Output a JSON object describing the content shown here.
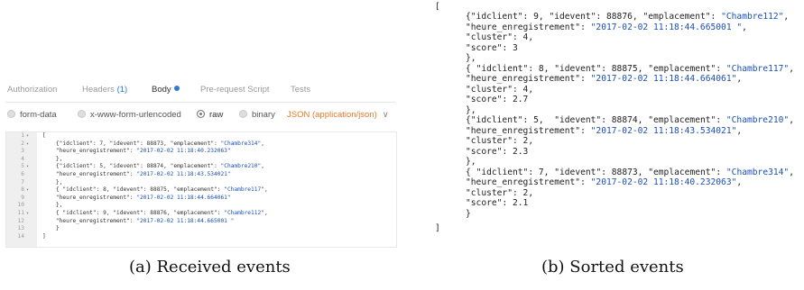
{
  "panel_a": {
    "tabs": [
      {
        "label": "Authorization"
      },
      {
        "label": "Headers",
        "count": "(1)"
      },
      {
        "label": "Body",
        "active": true
      },
      {
        "label": "Pre-request Script"
      },
      {
        "label": "Tests"
      }
    ],
    "body_types": [
      {
        "label": "form-data",
        "selected": false
      },
      {
        "label": "x-www-form-urlencoded",
        "selected": false
      },
      {
        "label": "raw",
        "selected": true
      },
      {
        "label": "binary",
        "selected": false
      }
    ],
    "content_type": "JSON (application/json)",
    "line_numbers": [
      "1",
      "2",
      "3",
      "4",
      "5",
      "6",
      "7",
      "8",
      "9",
      "10",
      "11",
      "12",
      "13",
      "14"
    ],
    "events": [
      {
        "idclient": "7",
        "idevent": "88873",
        "emplacement": "\"Chambre314\"",
        "heure": "\"2017-02-02 11:18:40.232063\""
      },
      {
        "idclient": "5",
        "idevent": "88874",
        "emplacement": "\"Chambre210\"",
        "heure": "\"2017-02-02 11:18:43.534021\""
      },
      {
        "idclient": "8",
        "idevent": "88875",
        "emplacement": "\"Chambre117\"",
        "heure": "\"2017-02-02 11:18:44.664061\""
      },
      {
        "idclient": "9",
        "idevent": "88876",
        "emplacement": "\"Chambre112\"",
        "heure": "\"2017-02-02 11:18:44.665001 \""
      }
    ],
    "caption": "(a) Received events"
  },
  "panel_b": {
    "events": [
      {
        "idclient": "9",
        "idevent": "88876",
        "emplacement": "\"Chambre112\"",
        "heure": "\"2017-02-02 11:18:44.665001 \"",
        "cluster": "4",
        "score": "3"
      },
      {
        "idclient": "8",
        "idevent": "88875",
        "emplacement": "\"Chambre117\"",
        "heure": "\"2017-02-02 11:18:44.664061\"",
        "cluster": "4",
        "score": "2.7"
      },
      {
        "idclient": "5",
        "idevent": "88874",
        "emplacement": "\"Chambre210\"",
        "heure": "\"2017-02-02 11:18:43.534021\"",
        "cluster": "2",
        "score": "2.3"
      },
      {
        "idclient": "7",
        "idevent": "88873",
        "emplacement": "\"Chambre314\"",
        "heure": "\"2017-02-02 11:18:40.232063\"",
        "cluster": "2",
        "score": "2.1"
      }
    ],
    "caption": "(b) Sorted events"
  },
  "keys": {
    "idclient": "\"idclient\"",
    "idevent": "\"idevent\"",
    "emplacement": "\"emplacement\"",
    "heure": "\"heure_enregistrement\"",
    "cluster": "\"cluster\"",
    "score": "\"score\""
  },
  "colors": {
    "accent": "#2e7bd6",
    "content_type": "#e8792a",
    "string": "#1a4fb5"
  }
}
